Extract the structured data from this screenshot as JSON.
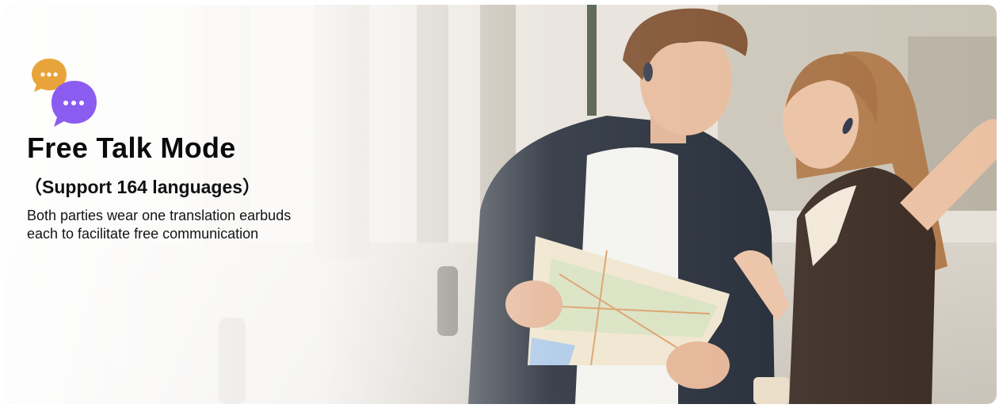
{
  "banner": {
    "title": "Free Talk Mode",
    "subtitle": "（Support 164 languages）",
    "description_line1": "Both parties wear one translation earbuds",
    "description_line2": "each to facilitate free communication"
  },
  "icons": {
    "chat": "chat-bubbles-icon",
    "earbud": "earbud-icon"
  },
  "colors": {
    "bubble_back": "#e8a43a",
    "bubble_front": "#8b5cf0",
    "text": "#0b0b0b"
  }
}
